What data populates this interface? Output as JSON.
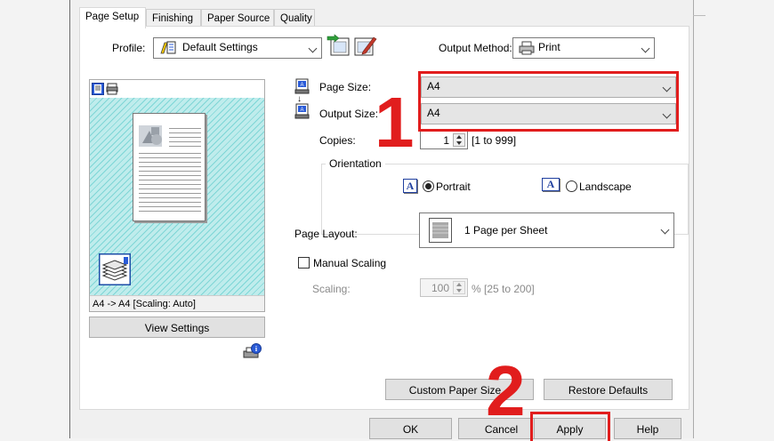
{
  "tabs": [
    "Page Setup",
    "Finishing",
    "Paper Source",
    "Quality"
  ],
  "profile": {
    "label": "Profile:",
    "value": "Default Settings"
  },
  "output_method": {
    "label": "Output Method:",
    "value": "Print"
  },
  "preview": {
    "caption": "A4 -> A4 [Scaling: Auto]",
    "view_settings": "View Settings"
  },
  "page_size": {
    "label": "Page Size:",
    "value": "A4"
  },
  "output_size": {
    "label": "Output Size:",
    "value": "A4"
  },
  "copies": {
    "label": "Copies:",
    "value": "1",
    "range": "[1 to 999]"
  },
  "orientation": {
    "title": "Orientation",
    "portrait": "Portrait",
    "landscape": "Landscape",
    "selected": "Portrait"
  },
  "page_layout": {
    "label": "Page Layout:",
    "value": "1 Page per Sheet"
  },
  "manual_scaling": {
    "label": "Manual Scaling",
    "checked": false
  },
  "scaling": {
    "label": "Scaling:",
    "value": "100",
    "range": "% [25 to 200]"
  },
  "buttons": {
    "custom_paper_size": "Custom Paper Size...",
    "restore_defaults": "Restore Defaults",
    "ok": "OK",
    "cancel": "Cancel",
    "apply": "Apply",
    "help": "Help"
  },
  "annotations": {
    "step1": "1",
    "step2": "2",
    "highlight_color": "#e11d1d"
  }
}
